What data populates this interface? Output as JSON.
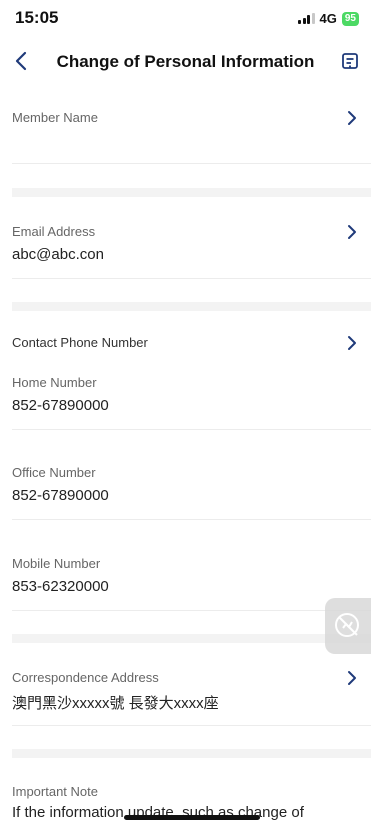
{
  "status": {
    "time": "15:05",
    "network": "4G",
    "battery": "95"
  },
  "nav": {
    "title": "Change of Personal Information"
  },
  "member": {
    "label": "Member Name",
    "value": ""
  },
  "email": {
    "label": "Email Address",
    "value": "abc@abc.con"
  },
  "phone": {
    "section_label": "Contact Phone Number",
    "home": {
      "label": "Home Number",
      "value": "852-67890000"
    },
    "office": {
      "label": "Office Number",
      "value": "852-67890000"
    },
    "mobile": {
      "label": "Mobile Number",
      "value": "853-62320000"
    }
  },
  "address": {
    "label": "Correspondence Address",
    "value": "澳門黑沙xxxxx號 長發大xxxx座"
  },
  "note": {
    "label": "Important Note",
    "text": "If the information update, such as change of"
  },
  "icons": {
    "back": "chevron-left-icon",
    "form": "form-icon",
    "chevron": "chevron-right-icon",
    "float": "assistive-icon"
  },
  "colors": {
    "battery": "#4cd964",
    "divider": "#ececec",
    "section_gap": "#f3f3f3"
  }
}
